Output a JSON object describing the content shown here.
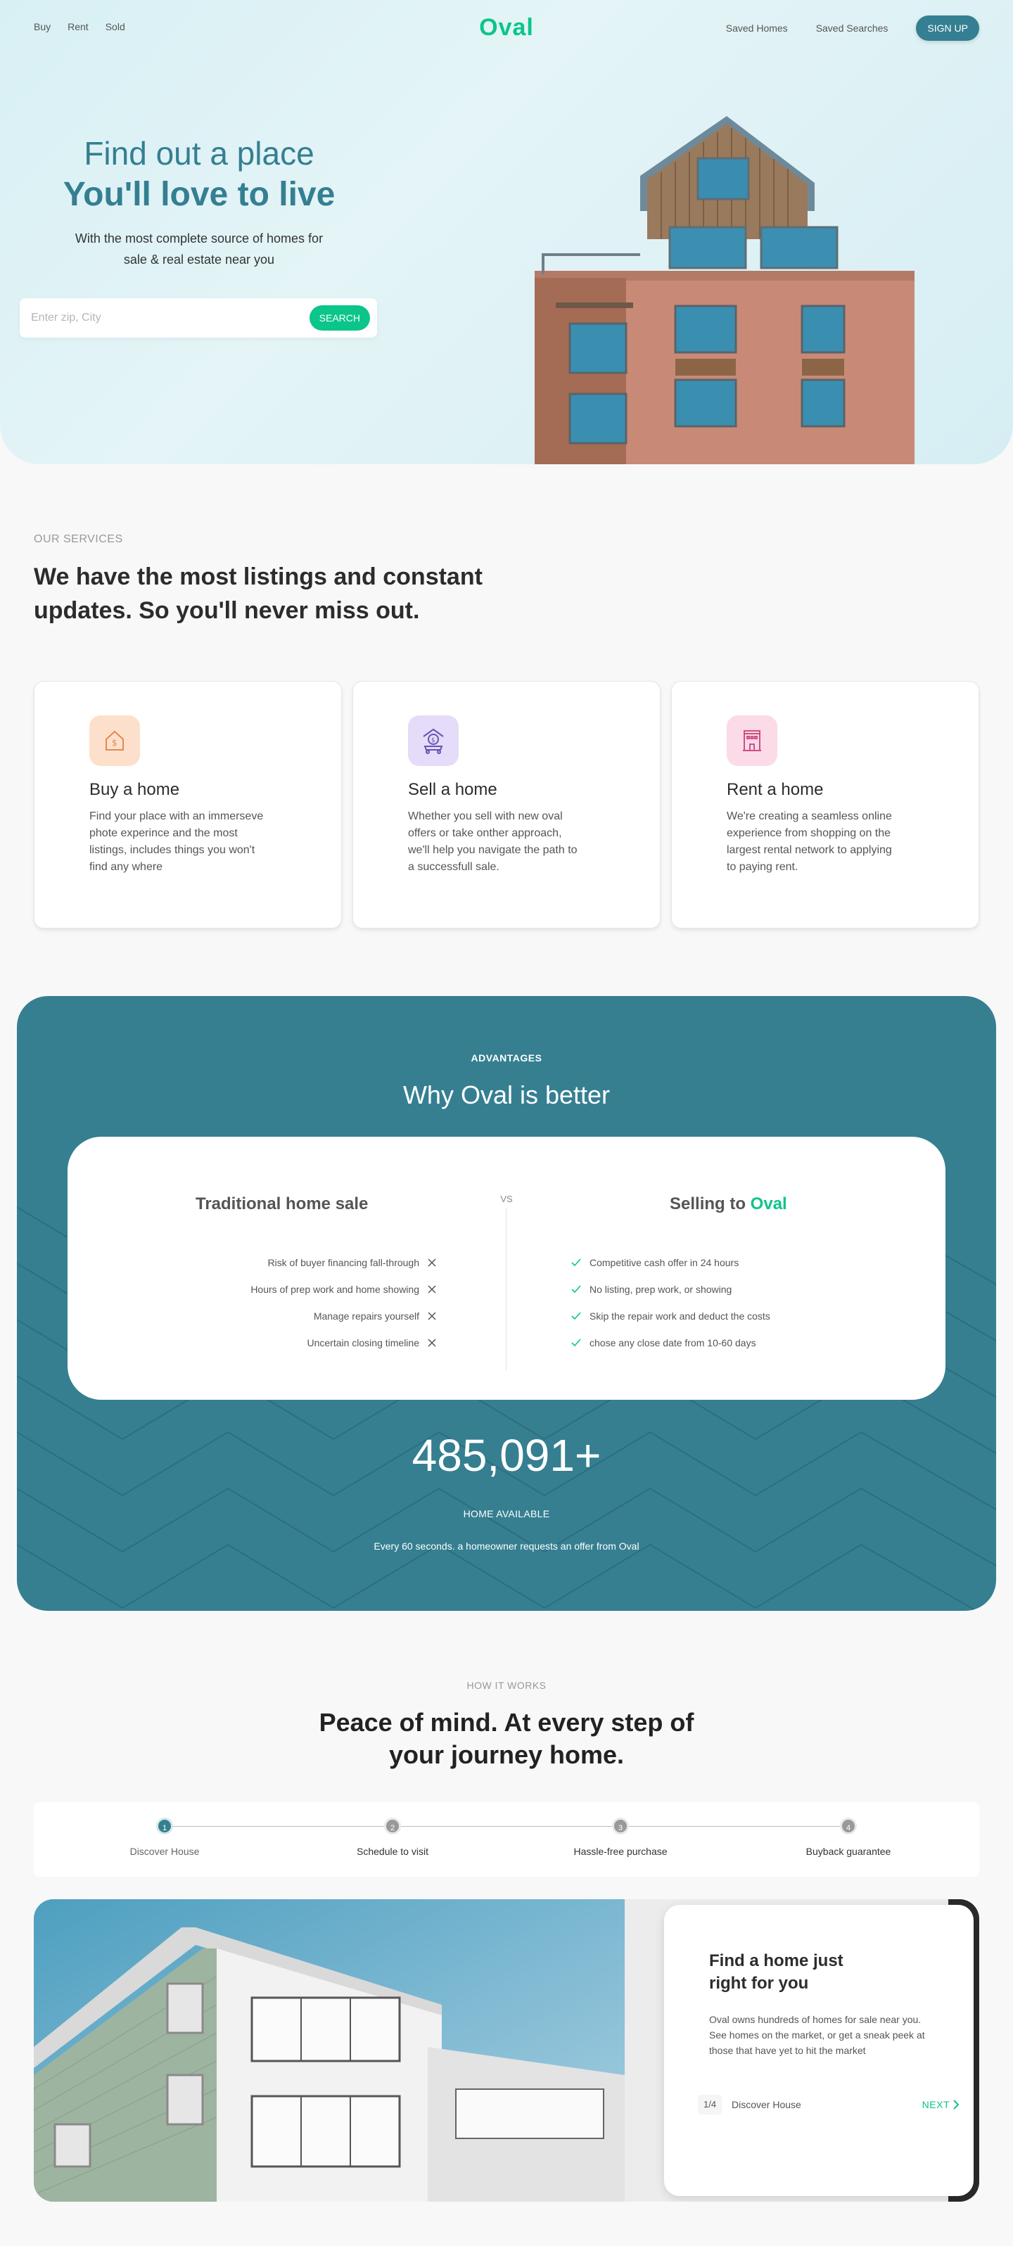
{
  "nav": {
    "left": [
      "Buy",
      "Rent",
      "Sold"
    ],
    "logo": "Oval",
    "saved_homes": "Saved Homes",
    "saved_searches": "Saved Searches",
    "signup": "SIGN UP"
  },
  "hero": {
    "line1": "Find out a place",
    "line2": "You'll love to live",
    "subtitle": "With the most complete source of homes for sale & real estate near you",
    "search_placeholder": "Enter zip, City",
    "search_button": "SEARCH"
  },
  "services": {
    "kicker": "OUR SERVICES",
    "title": "We have the most listings and constant updates. So you'll never miss out.",
    "cards": [
      {
        "title": "Buy a home",
        "text": "Find your place with an immerseve phote experince and the most listings, includes things you won't find any where",
        "icon": "house-dollar-icon",
        "bg": "#fde0cc",
        "color": "#e3894e"
      },
      {
        "title": "Sell a home",
        "text": "Whether you sell with new oval offers or take onther approach, we'll help you navigate the path to a successfull sale.",
        "icon": "house-cart-icon",
        "bg": "#e4dcf8",
        "color": "#6a52b5"
      },
      {
        "title": "Rent a home",
        "text": "We're creating a seamless online experience from shopping on the largest rental network to applying to paying rent.",
        "icon": "building-icon",
        "bg": "#fbdbe8",
        "color": "#cf4f83"
      }
    ]
  },
  "advantages": {
    "kicker": "ADVANTAGES",
    "title": "Why Oval is better",
    "left_title": "Traditional home sale",
    "vs": "VS",
    "right_title_prefix": "Selling to",
    "right_title_brand": "Oval",
    "left_items": [
      "Risk of buyer financing fall-through",
      "Hours of prep work and home showing",
      "Manage repairs yourself",
      "Uncertain closing timeline"
    ],
    "right_items": [
      "Competitive cash offer in 24 hours",
      "No listing, prep work, or showing",
      "Skip the repair work and deduct the costs",
      "chose any close date from 10-60 days"
    ],
    "count": "485,091+",
    "count_label": "HOME AVAILABLE",
    "note": "Every 60 seconds. a homeowner requests an offer from Oval"
  },
  "how": {
    "kicker": "HOW IT WORKS",
    "title": "Peace of mind. At every step of your journey home.",
    "steps": [
      {
        "num": "1",
        "label": "Discover House"
      },
      {
        "num": "2",
        "label": "Schedule to visit"
      },
      {
        "num": "3",
        "label": "Hassle-free purchase"
      },
      {
        "num": "4",
        "label": "Buyback guarantee"
      }
    ],
    "feature": {
      "title": "Find a home just right for you",
      "text": "Oval owns hundreds of homes for sale near you. See homes on the market, or get a sneak peek at those that have yet to hit the market",
      "page": "1/4",
      "page_label": "Discover House",
      "next": "NEXT"
    }
  },
  "colors": {
    "brand": "#0bc58a",
    "teal": "#357f91"
  }
}
